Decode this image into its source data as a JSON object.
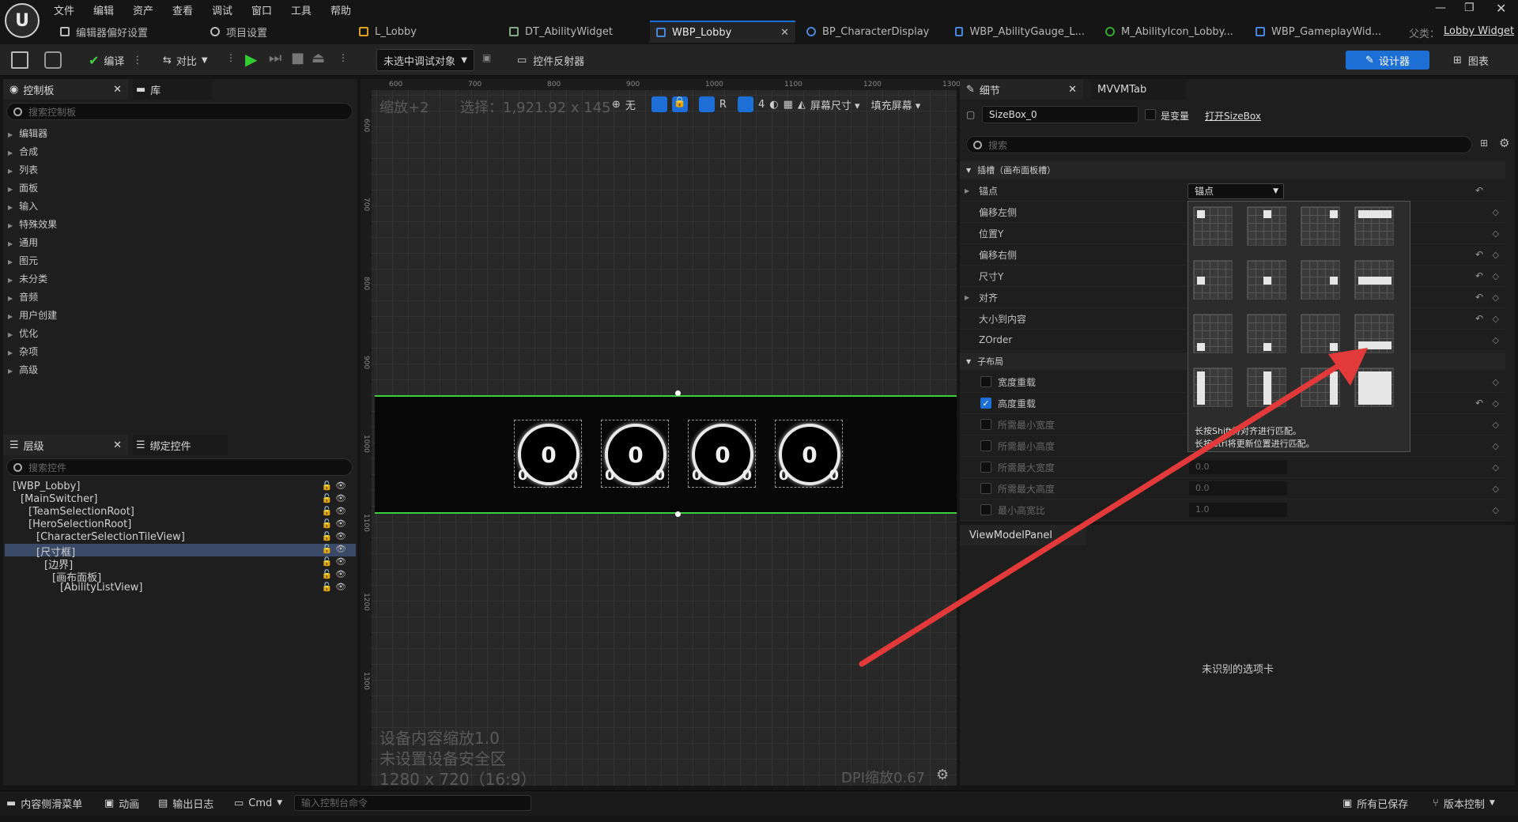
{
  "menu": [
    "文件",
    "编辑",
    "资产",
    "查看",
    "调试",
    "窗口",
    "工具",
    "帮助"
  ],
  "tabs": [
    {
      "label": "编辑器偏好设置"
    },
    {
      "label": "项目设置"
    },
    {
      "label": "L_Lobby"
    },
    {
      "label": "DT_AbilityWidget"
    },
    {
      "label": "WBP_Lobby",
      "active": true
    },
    {
      "label": "BP_CharacterDisplay"
    },
    {
      "label": "WBP_AbilityGauge_L..."
    },
    {
      "label": "M_AbilityIcon_Lobby..."
    },
    {
      "label": "WBP_GameplayWid..."
    }
  ],
  "parent_label": "父类：",
  "parent_class": "Lobby Widget",
  "toolbar": {
    "compile": "编译",
    "diff": "对比",
    "debug_target": "未选中调试对象",
    "widget_reflector": "控件反射器",
    "designer": "设计器",
    "graph": "图表"
  },
  "palette": {
    "tab1": "控制板",
    "tab2": "库",
    "search_placeholder": "搜索控制板",
    "categories": [
      "编辑器",
      "合成",
      "列表",
      "面板",
      "输入",
      "特殊效果",
      "通用",
      "图元",
      "未分类",
      "音频",
      "用户创建",
      "优化",
      "杂项",
      "高级"
    ]
  },
  "hierarchy": {
    "tab1": "层级",
    "tab2": "绑定控件",
    "search_placeholder": "搜索控件",
    "items": [
      {
        "label": "[WBP_Lobby]",
        "depth": 0
      },
      {
        "label": "[MainSwitcher]",
        "depth": 1
      },
      {
        "label": "[TeamSelectionRoot]",
        "depth": 2
      },
      {
        "label": "[HeroSelectionRoot]",
        "depth": 2
      },
      {
        "label": "[CharacterSelectionTileView]",
        "depth": 3
      },
      {
        "label": "[尺寸框]",
        "depth": 3,
        "selected": true
      },
      {
        "label": "[边界]",
        "depth": 4
      },
      {
        "label": "[画布面板]",
        "depth": 5
      },
      {
        "label": "[AbilityListView]",
        "depth": 6
      }
    ]
  },
  "viewport": {
    "zoom": "缩放+2",
    "selection": "选择：1,921.92 x 145",
    "none_label": "无",
    "r_label": "R",
    "grid_num": "4",
    "screen_size": "屏幕尺寸",
    "fill_screen": "填充屏幕",
    "ruler_h": [
      "600",
      "700",
      "800",
      "900",
      "1000",
      "1100",
      "1200",
      "1300"
    ],
    "ruler_v": [
      "600",
      "700",
      "800",
      "900",
      "1000",
      "1100",
      "1200",
      "1300"
    ],
    "gauges": [
      {
        "value": "0",
        "left": "0",
        "right": "0"
      },
      {
        "value": "0",
        "left": "0",
        "right": "0"
      },
      {
        "value": "0",
        "left": "0",
        "right": "0"
      },
      {
        "value": "0",
        "left": "0",
        "right": "0"
      }
    ],
    "device_scale": "设备内容缩放1.0",
    "safe_zone": "未设置设备安全区",
    "resolution": "1280 x 720（16:9）",
    "dpi": "DPI缩放0.67"
  },
  "details": {
    "tab1": "细节",
    "tab2": "MVVMTab",
    "name_value": "SizeBox_0",
    "is_variable": "是变量",
    "open_link": "打开SizeBox",
    "search_placeholder": "搜索",
    "section_slot": "插槽（画布面板槽）",
    "rows": [
      "锚点",
      "偏移左侧",
      "位置Y",
      "偏移右侧",
      "尺寸Y",
      "对齐",
      "大小到内容",
      "ZOrder"
    ],
    "anchor_dropdown": "锚点",
    "section_child": "子布局",
    "child_rows": [
      "宽度重载",
      "高度重载",
      "所需最小宽度",
      "所需最小高度",
      "所需最大宽度",
      "所需最大高度",
      "最小高宽比"
    ],
    "max_width_value": "0.0",
    "max_height_value": "0.0",
    "min_ratio_value": "1.0",
    "anchor_hint_1": "长按Shift将对齐进行匹配。",
    "anchor_hint_2": "长按Ctrl将更新位置进行匹配。",
    "viewmodel_tab": "ViewModelPanel",
    "unrecognized": "未识别的选项卡"
  },
  "status": {
    "content_drawer": "内容侧滑菜单",
    "animation": "动画",
    "output_log": "输出日志",
    "cmd": "Cmd",
    "cmd_placeholder": "输入控制台命令",
    "saved": "所有已保存",
    "source_control": "版本控制"
  },
  "colors": {
    "accent": "#1d6fd6",
    "selection_border": "#3ecf3e",
    "arrow": "#e23a3a"
  }
}
